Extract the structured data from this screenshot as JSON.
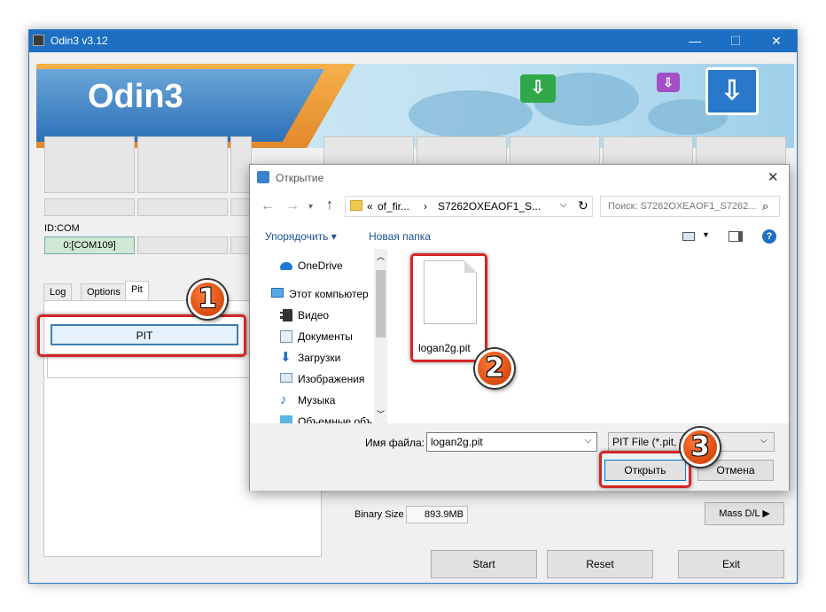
{
  "odin": {
    "title": "Odin3 v3.12",
    "logo": "Odin3",
    "minimize": "—",
    "maximize": "☐",
    "close": "✕",
    "id_com_label": "ID:COM",
    "com_port": "0:[COM109]",
    "tabs": [
      "Log",
      "Options",
      "Pit"
    ],
    "pit_button": "PIT",
    "binary_size_label": "Binary Size",
    "binary_size_value": "893.9MB",
    "mass_dl": "Mass D/L ▶",
    "start": "Start",
    "reset": "Reset",
    "exit": "Exit"
  },
  "dialog": {
    "title": "Открытие",
    "close": "✕",
    "path": [
      "«",
      "of_fir...",
      "›",
      "S7262OXEAOF1_S..."
    ],
    "search_placeholder": "Поиск: S7262OXEAOF1_S7262...",
    "organize": "Упорядочить ▾",
    "new_folder": "Новая папка",
    "nav_items": [
      {
        "label": "OneDrive",
        "icon": "cloud-icon"
      },
      {
        "label": "Этот компьютер",
        "icon": "computer-icon"
      },
      {
        "label": "Видео",
        "icon": "video-folder-icon"
      },
      {
        "label": "Документы",
        "icon": "documents-folder-icon"
      },
      {
        "label": "Загрузки",
        "icon": "download-arrow-icon"
      },
      {
        "label": "Изображения",
        "icon": "pictures-folder-icon"
      },
      {
        "label": "Музыка",
        "icon": "music-note-icon"
      },
      {
        "label": "Объемные объ...",
        "icon": "3d-objects-icon"
      }
    ],
    "file_name": "logan2g.pit",
    "filename_label": "Имя файла:",
    "filename_value": "logan2g.pit",
    "filter_value": "PIT File (*.pit, *",
    "open": "Открыть",
    "cancel": "Отмена"
  },
  "annotations": [
    "1",
    "2",
    "3"
  ],
  "colors": {
    "titlebar": "#1c6fc2",
    "annotation_red": "#d32626",
    "badge_orange": "#e2581a"
  }
}
